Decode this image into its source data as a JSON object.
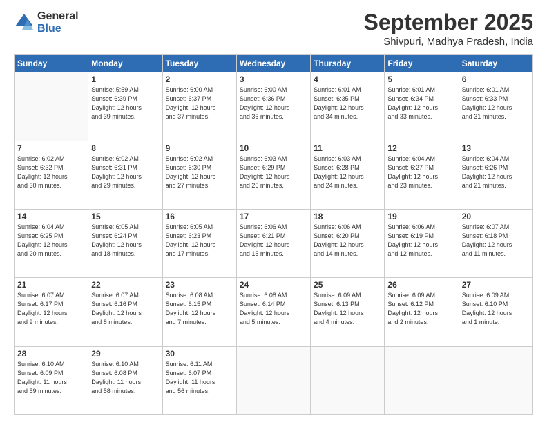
{
  "logo": {
    "general": "General",
    "blue": "Blue"
  },
  "header": {
    "month": "September 2025",
    "location": "Shivpuri, Madhya Pradesh, India"
  },
  "days_of_week": [
    "Sunday",
    "Monday",
    "Tuesday",
    "Wednesday",
    "Thursday",
    "Friday",
    "Saturday"
  ],
  "weeks": [
    [
      {
        "day": "",
        "info": ""
      },
      {
        "day": "1",
        "info": "Sunrise: 5:59 AM\nSunset: 6:39 PM\nDaylight: 12 hours\nand 39 minutes."
      },
      {
        "day": "2",
        "info": "Sunrise: 6:00 AM\nSunset: 6:37 PM\nDaylight: 12 hours\nand 37 minutes."
      },
      {
        "day": "3",
        "info": "Sunrise: 6:00 AM\nSunset: 6:36 PM\nDaylight: 12 hours\nand 36 minutes."
      },
      {
        "day": "4",
        "info": "Sunrise: 6:01 AM\nSunset: 6:35 PM\nDaylight: 12 hours\nand 34 minutes."
      },
      {
        "day": "5",
        "info": "Sunrise: 6:01 AM\nSunset: 6:34 PM\nDaylight: 12 hours\nand 33 minutes."
      },
      {
        "day": "6",
        "info": "Sunrise: 6:01 AM\nSunset: 6:33 PM\nDaylight: 12 hours\nand 31 minutes."
      }
    ],
    [
      {
        "day": "7",
        "info": "Sunrise: 6:02 AM\nSunset: 6:32 PM\nDaylight: 12 hours\nand 30 minutes."
      },
      {
        "day": "8",
        "info": "Sunrise: 6:02 AM\nSunset: 6:31 PM\nDaylight: 12 hours\nand 29 minutes."
      },
      {
        "day": "9",
        "info": "Sunrise: 6:02 AM\nSunset: 6:30 PM\nDaylight: 12 hours\nand 27 minutes."
      },
      {
        "day": "10",
        "info": "Sunrise: 6:03 AM\nSunset: 6:29 PM\nDaylight: 12 hours\nand 26 minutes."
      },
      {
        "day": "11",
        "info": "Sunrise: 6:03 AM\nSunset: 6:28 PM\nDaylight: 12 hours\nand 24 minutes."
      },
      {
        "day": "12",
        "info": "Sunrise: 6:04 AM\nSunset: 6:27 PM\nDaylight: 12 hours\nand 23 minutes."
      },
      {
        "day": "13",
        "info": "Sunrise: 6:04 AM\nSunset: 6:26 PM\nDaylight: 12 hours\nand 21 minutes."
      }
    ],
    [
      {
        "day": "14",
        "info": "Sunrise: 6:04 AM\nSunset: 6:25 PM\nDaylight: 12 hours\nand 20 minutes."
      },
      {
        "day": "15",
        "info": "Sunrise: 6:05 AM\nSunset: 6:24 PM\nDaylight: 12 hours\nand 18 minutes."
      },
      {
        "day": "16",
        "info": "Sunrise: 6:05 AM\nSunset: 6:23 PM\nDaylight: 12 hours\nand 17 minutes."
      },
      {
        "day": "17",
        "info": "Sunrise: 6:06 AM\nSunset: 6:21 PM\nDaylight: 12 hours\nand 15 minutes."
      },
      {
        "day": "18",
        "info": "Sunrise: 6:06 AM\nSunset: 6:20 PM\nDaylight: 12 hours\nand 14 minutes."
      },
      {
        "day": "19",
        "info": "Sunrise: 6:06 AM\nSunset: 6:19 PM\nDaylight: 12 hours\nand 12 minutes."
      },
      {
        "day": "20",
        "info": "Sunrise: 6:07 AM\nSunset: 6:18 PM\nDaylight: 12 hours\nand 11 minutes."
      }
    ],
    [
      {
        "day": "21",
        "info": "Sunrise: 6:07 AM\nSunset: 6:17 PM\nDaylight: 12 hours\nand 9 minutes."
      },
      {
        "day": "22",
        "info": "Sunrise: 6:07 AM\nSunset: 6:16 PM\nDaylight: 12 hours\nand 8 minutes."
      },
      {
        "day": "23",
        "info": "Sunrise: 6:08 AM\nSunset: 6:15 PM\nDaylight: 12 hours\nand 7 minutes."
      },
      {
        "day": "24",
        "info": "Sunrise: 6:08 AM\nSunset: 6:14 PM\nDaylight: 12 hours\nand 5 minutes."
      },
      {
        "day": "25",
        "info": "Sunrise: 6:09 AM\nSunset: 6:13 PM\nDaylight: 12 hours\nand 4 minutes."
      },
      {
        "day": "26",
        "info": "Sunrise: 6:09 AM\nSunset: 6:12 PM\nDaylight: 12 hours\nand 2 minutes."
      },
      {
        "day": "27",
        "info": "Sunrise: 6:09 AM\nSunset: 6:10 PM\nDaylight: 12 hours\nand 1 minute."
      }
    ],
    [
      {
        "day": "28",
        "info": "Sunrise: 6:10 AM\nSunset: 6:09 PM\nDaylight: 11 hours\nand 59 minutes."
      },
      {
        "day": "29",
        "info": "Sunrise: 6:10 AM\nSunset: 6:08 PM\nDaylight: 11 hours\nand 58 minutes."
      },
      {
        "day": "30",
        "info": "Sunrise: 6:11 AM\nSunset: 6:07 PM\nDaylight: 11 hours\nand 56 minutes."
      },
      {
        "day": "",
        "info": ""
      },
      {
        "day": "",
        "info": ""
      },
      {
        "day": "",
        "info": ""
      },
      {
        "day": "",
        "info": ""
      }
    ]
  ]
}
